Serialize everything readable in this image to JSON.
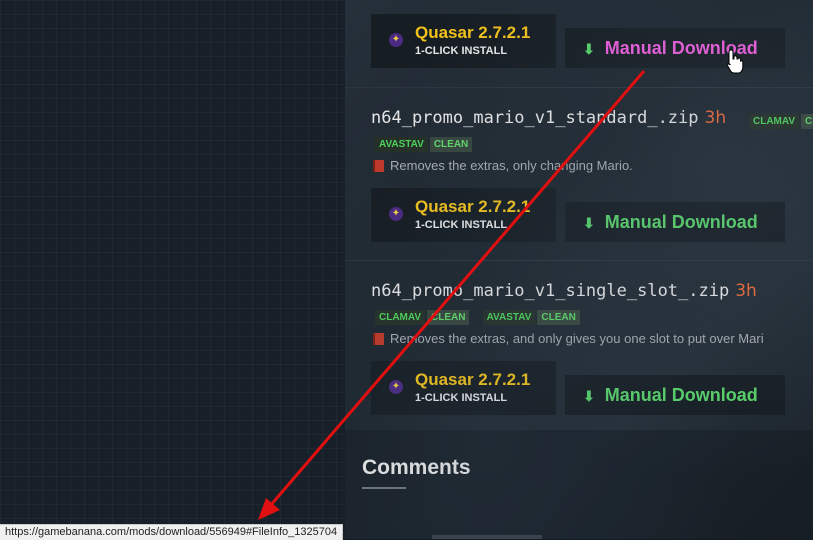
{
  "files": [
    {
      "install": {
        "title": "Quasar 2.7.2.1",
        "subtitle": "1-CLICK INSTALL",
        "icon": "quasar-icon"
      },
      "download": {
        "label": "Manual Download",
        "icon": "download-arrow-icon"
      }
    },
    {
      "name": "n64_promo_mario_v1_standard_.zip",
      "age": "3h",
      "badges": [
        "CLAMAV",
        "C",
        "AVASTAV",
        "CLEAN"
      ],
      "description": "Removes the extras, only changing Mario.",
      "install": {
        "title": "Quasar 2.7.2.1",
        "subtitle": "1-CLICK INSTALL",
        "icon": "quasar-icon"
      },
      "download": {
        "label": "Manual Download",
        "icon": "download-arrow-icon"
      }
    },
    {
      "name": "n64_promo_mario_v1_single_slot_.zip",
      "age": "3h",
      "badges": [
        "CLAMAV",
        "CLEAN",
        "AVASTAV",
        "CLEAN"
      ],
      "description": "Removes the extras, and only gives you one slot to put over Mari",
      "install": {
        "title": "Quasar 2.7.2.1",
        "subtitle": "1-CLICK INSTALL",
        "icon": "quasar-icon"
      },
      "download": {
        "label": "Manual Download",
        "icon": "download-arrow-icon"
      }
    }
  ],
  "comments": {
    "title": "Comments"
  },
  "statusbar": {
    "url": "https://gamebanana.com/mods/download/556949#FileInfo_1325704"
  },
  "colors": {
    "accent_green": "#58d36a",
    "hover_pink": "#ee5ddd",
    "quasar_yellow": "#f2c21b",
    "annotation_red": "#e01010"
  }
}
